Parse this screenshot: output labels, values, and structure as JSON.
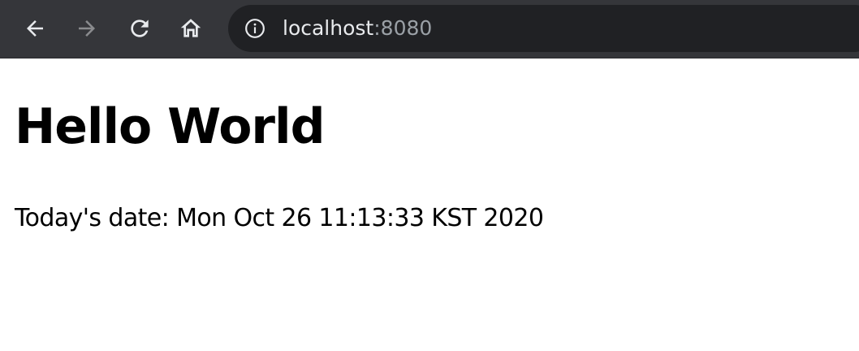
{
  "browser": {
    "nav": {
      "back_icon": "arrow-left-icon",
      "forward_icon": "arrow-right-icon",
      "reload_icon": "reload-icon",
      "home_icon": "home-icon"
    },
    "address_bar": {
      "security_icon": "info-circle-icon",
      "host": "localhost",
      "port": ":8080"
    },
    "colors": {
      "toolbar_bg": "#35363a",
      "omnibox_bg": "#202124",
      "icon_active": "#e8eaed",
      "icon_disabled": "#8a8b8e",
      "url_port": "#9aa0a6"
    }
  },
  "page": {
    "heading": "Hello World",
    "date_text": "Today's date: Mon Oct 26 11:13:33 KST 2020"
  }
}
